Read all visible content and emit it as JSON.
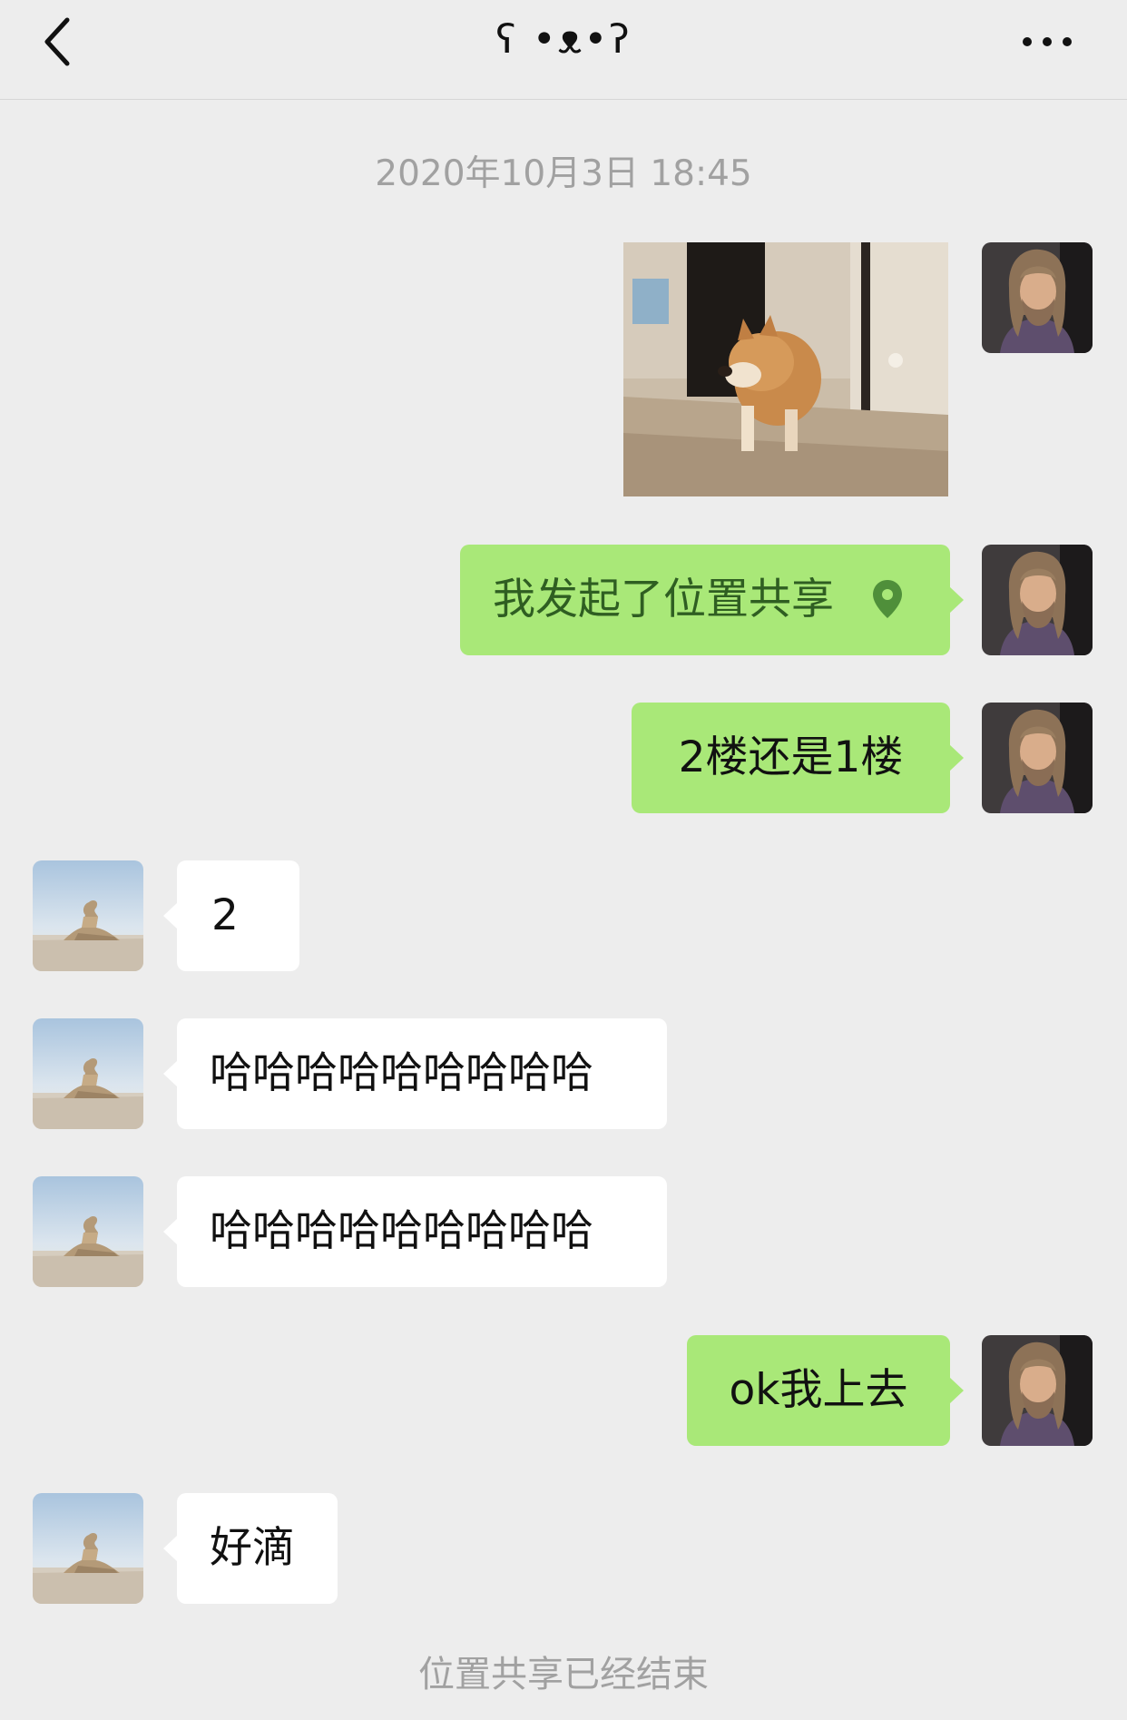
{
  "header": {
    "title": "ʕ •ᴥ•ʔ",
    "back_icon": "chevron-left-icon",
    "more_icon": "more-dots-icon"
  },
  "timestamp": "2020年10月3日 18:45",
  "messages": [
    {
      "type": "image",
      "side": "sent",
      "alt": "dog-gif"
    },
    {
      "type": "text",
      "side": "sent",
      "text": "我发起了位置共享",
      "icon": "location-pin-icon"
    },
    {
      "type": "text",
      "side": "sent",
      "text": "2楼还是1楼"
    },
    {
      "type": "text",
      "side": "received",
      "text": "2"
    },
    {
      "type": "text",
      "side": "received",
      "text": "哈哈哈哈哈哈哈哈哈"
    },
    {
      "type": "text",
      "side": "received",
      "text": "哈哈哈哈哈哈哈哈哈"
    },
    {
      "type": "text",
      "side": "sent",
      "text": "ok我上去"
    },
    {
      "type": "text",
      "side": "received",
      "text": "好滴"
    }
  ],
  "system_note": "位置共享已经结束",
  "colors": {
    "background": "#ededed",
    "sent_bubble": "#a9e878",
    "received_bubble": "#ffffff",
    "muted_text": "#a1a1a1"
  }
}
